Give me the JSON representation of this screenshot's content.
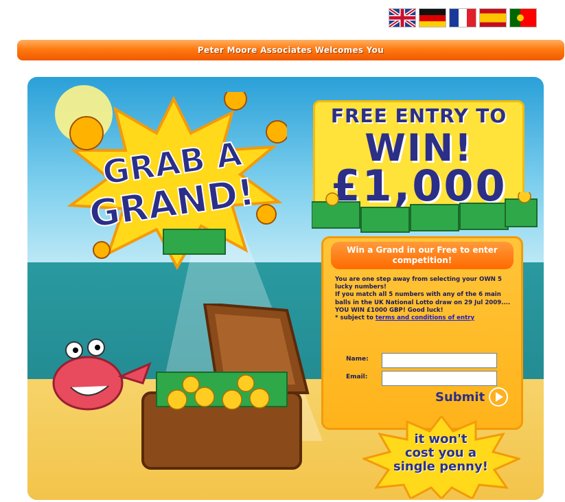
{
  "languages": [
    {
      "code": "en",
      "icon": "flag-uk-icon"
    },
    {
      "code": "de",
      "icon": "flag-germany-icon"
    },
    {
      "code": "fr",
      "icon": "flag-france-icon"
    },
    {
      "code": "es",
      "icon": "flag-spain-icon"
    },
    {
      "code": "pt",
      "icon": "flag-portugal-icon"
    }
  ],
  "banner": {
    "text": "Peter Moore Associates Welcomes You"
  },
  "hero": {
    "logo_line1": "GRAB A",
    "logo_line2": "GRAND!",
    "prize_line1": "FREE ENTRY TO",
    "prize_line2": "WIN!",
    "prize_line3": "£1,000"
  },
  "form": {
    "heading": "Win a Grand in our Free to enter competition!",
    "intro_line1": "You are one step away from selecting your OWN 5 lucky numbers!",
    "intro_line2": "If you match all 5 numbers with any of the 6 main balls in the UK National Lotto draw on 29 Jul 2009....",
    "intro_line3": "YOU WIN £1000 GBP! Good luck!",
    "terms_prefix": "* subject to ",
    "terms_link": "terms and conditions of entry",
    "name_label": "Name:",
    "email_label": "Email:",
    "name_value": "",
    "email_value": "",
    "submit_label": "Submit"
  },
  "starburst": {
    "line1": "it won't",
    "line2": "cost you a",
    "line3": "single penny!"
  },
  "colors": {
    "banner_orange": "#ff7a10",
    "navy_text": "#2b2f88",
    "prize_yellow": "#ffe23a",
    "form_orange": "#ffb31a"
  }
}
